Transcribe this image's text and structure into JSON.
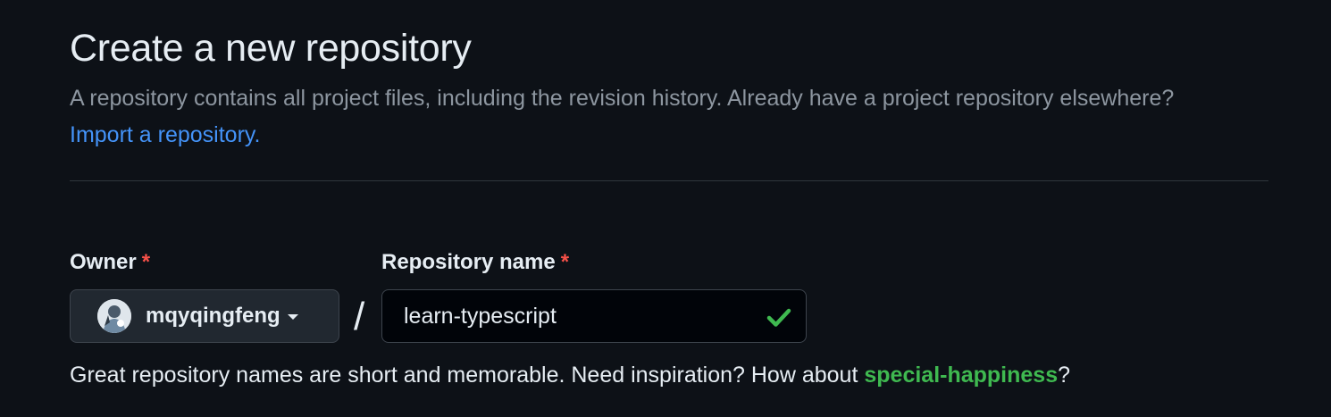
{
  "header": {
    "title": "Create a new repository",
    "description_text": "A repository contains all project files, including the revision history. Already have a project repository elsewhere?",
    "import_link": "Import a repository."
  },
  "form": {
    "owner_label": "Owner",
    "repo_label": "Repository name",
    "required_marker": "*",
    "owner_value": "mqyqingfeng",
    "separator": "/",
    "repo_value": "learn-typescript",
    "repo_valid_icon": "check-icon",
    "hint_prefix": "Great repository names are short and memorable. Need inspiration? How about",
    "hint_suggestion": "special-happiness",
    "hint_suffix": "?"
  },
  "colors": {
    "background": "#0d1117",
    "link": "#4493f8",
    "required": "#f85149",
    "success": "#3fb950"
  }
}
